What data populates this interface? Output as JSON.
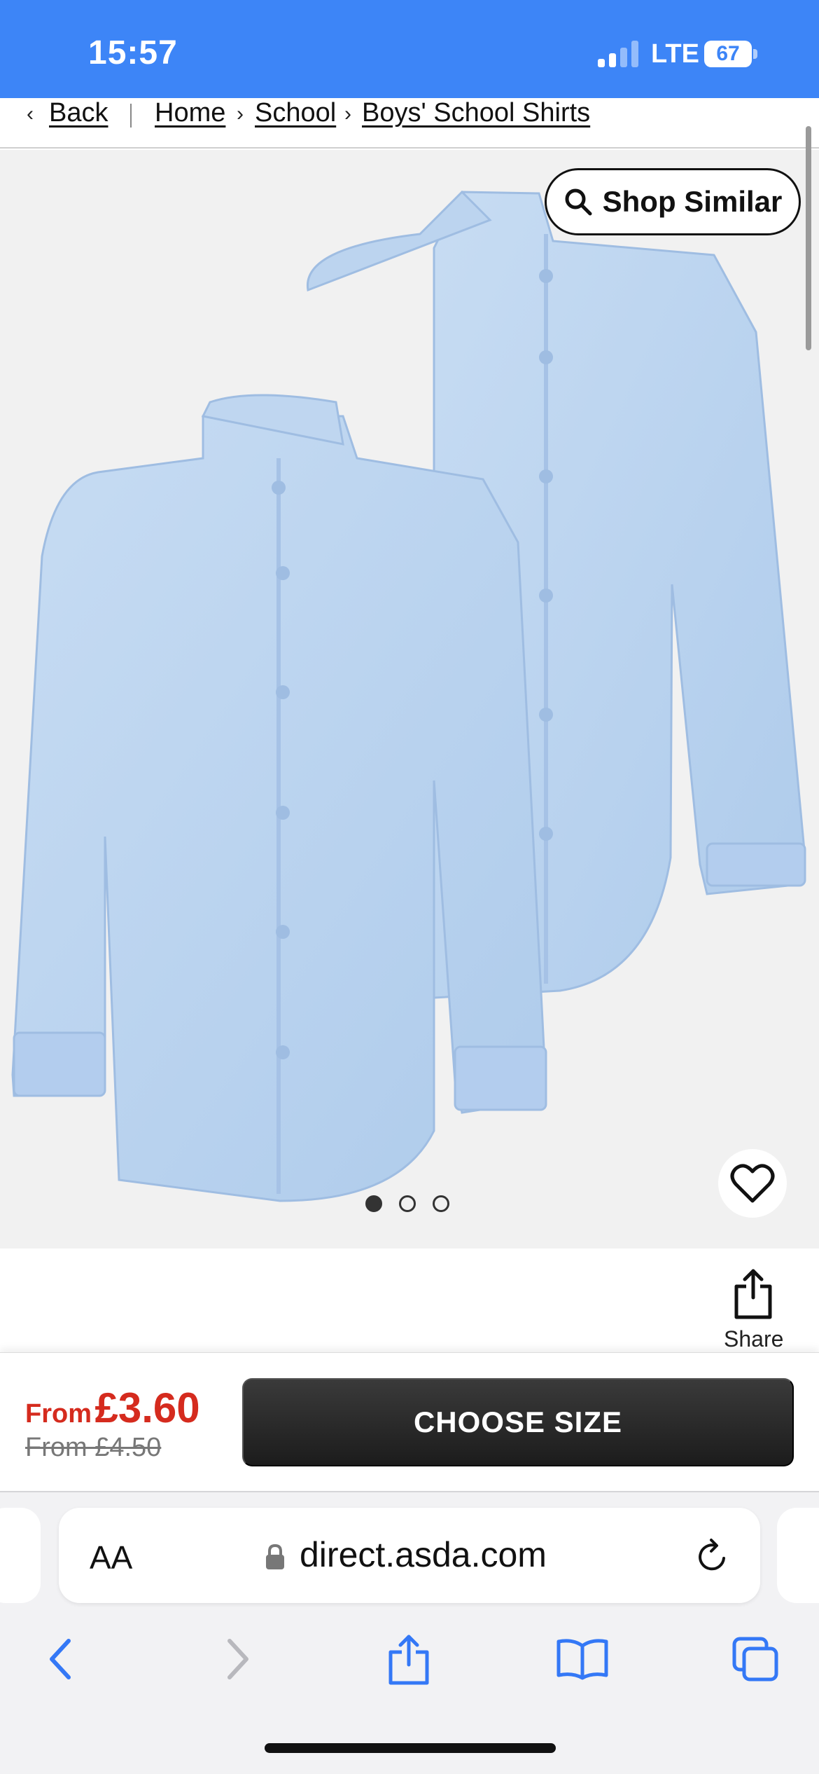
{
  "status_bar": {
    "time": "15:57",
    "network": "LTE",
    "battery": "67"
  },
  "breadcrumb": {
    "back": "Back",
    "items": [
      "Home",
      "School",
      "Boys' School Shirts"
    ]
  },
  "product": {
    "shop_similar": "Shop Similar",
    "image_count": 3,
    "active_image": 1,
    "share_label": "Share"
  },
  "price": {
    "current_prefix": "From",
    "current_amount": "£3.60",
    "was": "From £4.50"
  },
  "cta": {
    "choose_size": "CHOOSE SIZE"
  },
  "browser": {
    "text_size": "AA",
    "url": "direct.asda.com"
  },
  "colors": {
    "status_bar": "#3d85f7",
    "price_red": "#d52b1e",
    "safari_blue": "#3478f6",
    "shirt_blue": "#b9d3ef"
  }
}
